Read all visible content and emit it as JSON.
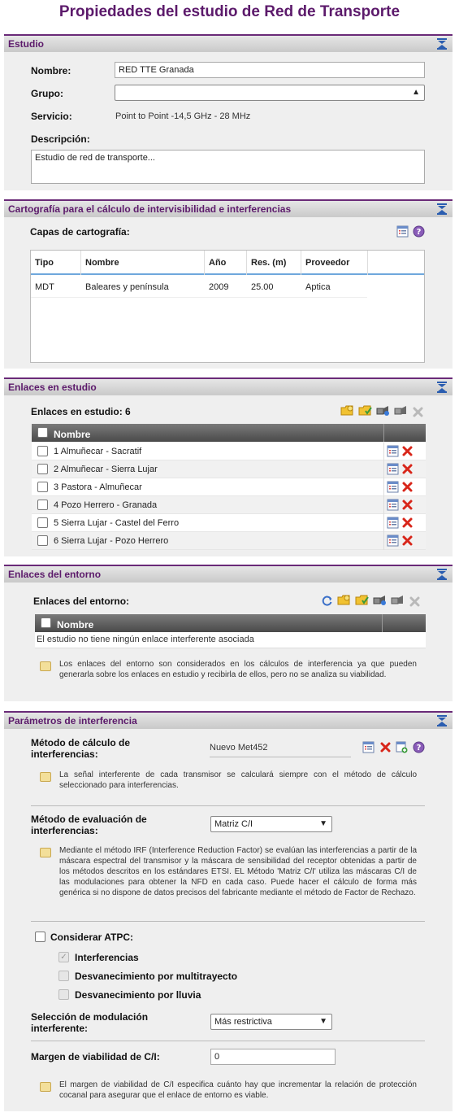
{
  "page": {
    "title": "Propiedades del estudio de Red de Transporte"
  },
  "estudio": {
    "header": "Estudio",
    "nombre_label": "Nombre:",
    "nombre_value": "RED TTE Granada",
    "grupo_label": "Grupo:",
    "grupo_value": "",
    "servicio_label": "Servicio:",
    "servicio_value": "Point to Point -14,5 GHz - 28 MHz",
    "descripcion_label": "Descripción:",
    "descripcion_value": "Estudio de red de transporte..."
  },
  "cartografia": {
    "header": "Cartografía para el cálculo de intervisibilidad e interferencias",
    "capas_label": "Capas de cartografía:",
    "columns": [
      "Tipo",
      "Nombre",
      "Año",
      "Res. (m)",
      "Proveedor"
    ],
    "rows": [
      [
        "MDT",
        "Baleares y península",
        "2009",
        "25.00",
        "Aptica"
      ]
    ]
  },
  "enlaces_estudio": {
    "header": "Enlaces en estudio",
    "count_label": "Enlaces en estudio: 6",
    "column_nombre": "Nombre",
    "items": [
      "1 Almuñecar - Sacratif",
      "2 Almuñecar - Sierra Lujar",
      "3 Pastora - Almuñecar",
      "4 Pozo Herrero - Granada",
      "5 Sierra Lujar - Castel del Ferro",
      "6 Sierra Lujar - Pozo Herrero"
    ]
  },
  "enlaces_entorno": {
    "header": "Enlaces del entorno",
    "label": "Enlaces del entorno:",
    "column_nombre": "Nombre",
    "empty_text": "El estudio no tiene ningún enlace interferente asociada",
    "note": "Los enlaces del entorno son considerados en los cálculos de interferencia ya que pueden generarla sobre los enlaces en estudio y recibirla de ellos, pero no se analiza su viabilidad."
  },
  "interferencia": {
    "header": "Parámetros de interferencia",
    "metodo_calculo_label": "Método de cálculo de interferencias:",
    "metodo_calculo_value": "Nuevo Met452",
    "metodo_calculo_note": "La señal interferente de cada transmisor se calculará siempre con el método de cálculo seleccionado para interferencias.",
    "metodo_eval_label": "Método de evaluación de interferencias:",
    "metodo_eval_value": "Matriz C/I",
    "metodo_eval_note": "Mediante el método IRF (Interference Reduction Factor) se evalúan las interferencias a partir de la máscara espectral del transmisor y la máscara de sensibilidad del receptor obtenidas a partir de los métodos descritos en los estándares ETSI. EL Método 'Matriz C/I' utiliza las máscaras C/I de las modulaciones para obtener la NFD en cada caso. Puede hacer el cálculo de forma más genérica si no dispone de datos precisos del fabricante mediante el método de Factor de Rechazo.",
    "atpc_label": "Considerar ATPC:",
    "atpc_opt1": "Interferencias",
    "atpc_opt2": "Desvanecimiento por multitrayecto",
    "atpc_opt3": "Desvanecimiento por lluvia",
    "modulacion_label": "Selección de modulación interferente:",
    "modulacion_value": "Más restrictiva",
    "margen_label": "Margen de viabilidad de C/I:",
    "margen_value": "0",
    "margen_note": "El margen de viabilidad de C/I especifica cuánto hay que incrementar la relación de protección cocanal para asegurar que el enlace de entorno es viable."
  },
  "colors": {
    "accent": "#5c1a6b",
    "icon_blue": "#2a5db0",
    "delete_red": "#d8261a"
  }
}
